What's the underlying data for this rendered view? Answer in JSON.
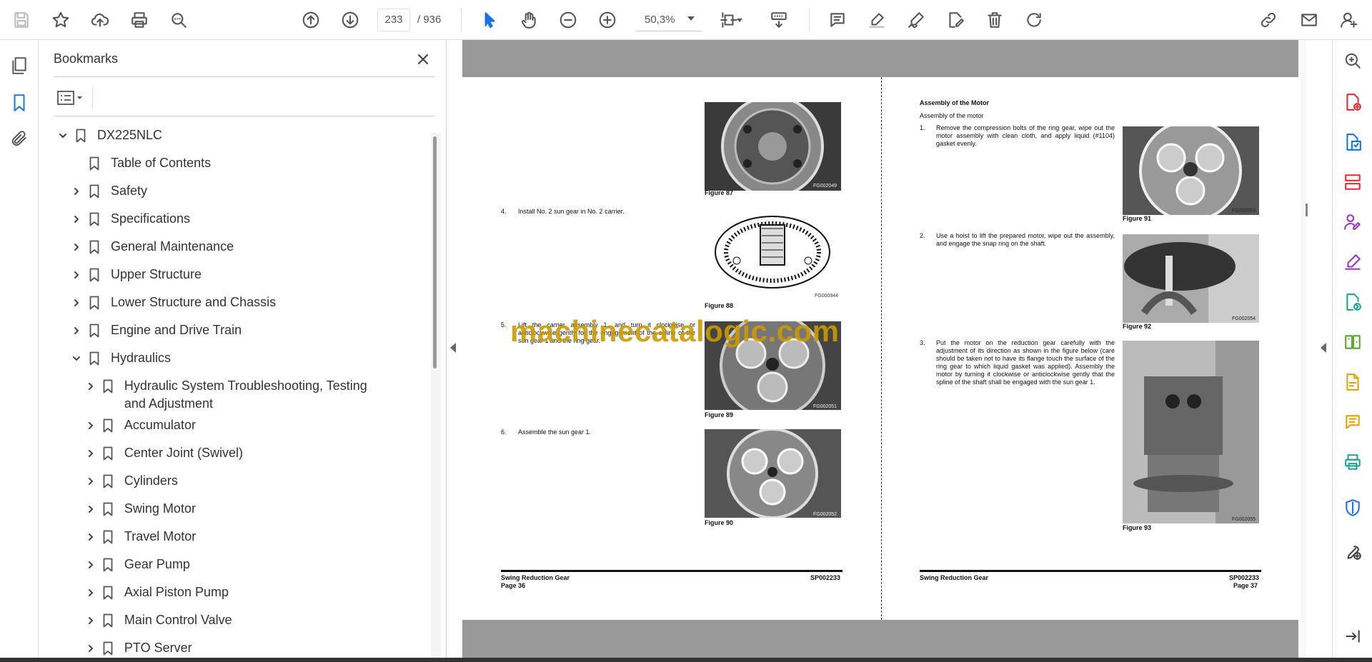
{
  "toolbar": {
    "current_page": "233",
    "page_total": "/ 936",
    "zoom": "50,3%"
  },
  "panel": {
    "title": "Bookmarks",
    "items": [
      {
        "label": "DX225NLC",
        "level": 0,
        "state": "expanded"
      },
      {
        "label": "Table of Contents",
        "level": 1,
        "state": "leaf"
      },
      {
        "label": "Safety",
        "level": 1,
        "state": "collapsed"
      },
      {
        "label": "Specifications",
        "level": 1,
        "state": "collapsed"
      },
      {
        "label": "General Maintenance",
        "level": 1,
        "state": "collapsed"
      },
      {
        "label": "Upper Structure",
        "level": 1,
        "state": "collapsed"
      },
      {
        "label": "Lower Structure and Chassis",
        "level": 1,
        "state": "collapsed"
      },
      {
        "label": "Engine and Drive Train",
        "level": 1,
        "state": "collapsed"
      },
      {
        "label": "Hydraulics",
        "level": 1,
        "state": "expanded"
      },
      {
        "label": "Hydraulic System Troubleshooting, Testing and Adjustment",
        "level": 2,
        "state": "collapsed"
      },
      {
        "label": "Accumulator",
        "level": 2,
        "state": "collapsed"
      },
      {
        "label": "Center Joint (Swivel)",
        "level": 2,
        "state": "collapsed"
      },
      {
        "label": "Cylinders",
        "level": 2,
        "state": "collapsed"
      },
      {
        "label": "Swing Motor",
        "level": 2,
        "state": "collapsed"
      },
      {
        "label": "Travel Motor",
        "level": 2,
        "state": "collapsed"
      },
      {
        "label": "Gear Pump",
        "level": 2,
        "state": "collapsed"
      },
      {
        "label": "Axial Piston Pump",
        "level": 2,
        "state": "collapsed"
      },
      {
        "label": "Main Control Valve",
        "level": 2,
        "state": "collapsed"
      },
      {
        "label": "PTO Server",
        "level": 2,
        "state": "collapsed"
      }
    ]
  },
  "document": {
    "watermark": "machinecatalogic.com",
    "left_page": {
      "steps": [
        {
          "num": "4.",
          "text": "Install No. 2 sun gear in No. 2 carrier."
        },
        {
          "num": "5.",
          "text": "Lift the carrier assembly 1, and turn it clockwise or anticlockwise gently for the engagement of the spline of the sun gear 1 and the ring gear."
        },
        {
          "num": "6.",
          "text": "Assemble the sun gear 1."
        }
      ],
      "figures": [
        {
          "caption": "Figure 87",
          "code": "FG002049"
        },
        {
          "caption": "Figure 88",
          "code": "FG000944"
        },
        {
          "caption": "Figure 89",
          "code": "FG002051"
        },
        {
          "caption": "Figure 90",
          "code": "FG002052"
        }
      ],
      "footer_title": "Swing Reduction Gear",
      "footer_page": "Page 36",
      "footer_code": "SP002233"
    },
    "right_page": {
      "heading": "Assembly of the Motor",
      "subheading": "Assembly of the motor",
      "steps": [
        {
          "num": "1.",
          "text": "Remove the compression bolts of the ring gear, wipe out the motor assembly with clean cloth, and apply liquid (#1104) gasket evenly."
        },
        {
          "num": "2.",
          "text": "Use a hoist to lift the prepared motor, wipe out the assembly, and engage the snap ring on the shaft."
        },
        {
          "num": "3.",
          "text": "Put the motor on the reduction gear carefully with the adjustment of its direction as shown in the figure below (care should be taken not to have its flange touch the surface of the ring gear to which liquid gasket was applied). Assembly the motor by turning it clockwise or anticlockwise gently that the spline of the shaft shall be engaged with the sun gear 1."
        }
      ],
      "figures": [
        {
          "caption": "Figure 91",
          "code": "FG002053"
        },
        {
          "caption": "Figure 92",
          "code": "FG002054"
        },
        {
          "caption": "Figure 93",
          "code": "FG002055"
        }
      ],
      "footer_title": "Swing Reduction Gear",
      "footer_page": "Page 37",
      "footer_code": "SP002233"
    }
  }
}
